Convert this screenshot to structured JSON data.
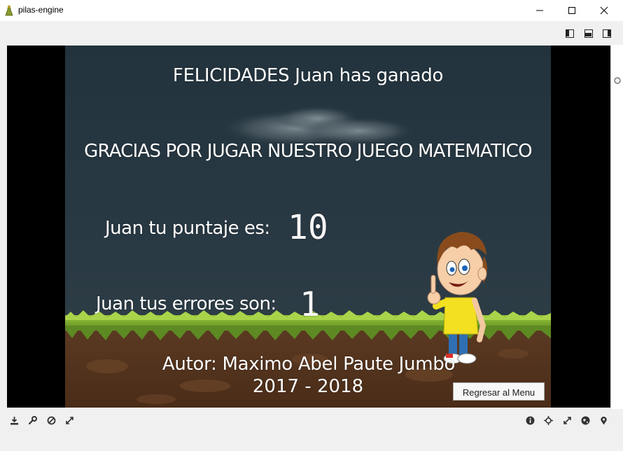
{
  "window": {
    "title": "pilas-engine",
    "controls": {
      "minimize": "minimize-icon",
      "maximize": "maximize-icon",
      "close": "close-icon"
    }
  },
  "layout_buttons": [
    "layout-left-icon",
    "layout-bottom-icon",
    "layout-right-icon"
  ],
  "game": {
    "title": "FELICIDADES Juan has ganado",
    "thanks": "GRACIAS POR JUGAR NUESTRO JUEGO MATEMATICO",
    "score_label": "Juan tu puntaje es:",
    "score_value": "10",
    "errors_label": "Juan tus errores son:",
    "errors_value": "1",
    "author": "Autor: Maximo Abel Paute Jumbo",
    "years": "2017 - 2018",
    "menu_button": "Regresar al Menu"
  },
  "toolbar_left": [
    "download-icon",
    "wrench-icon",
    "stop-icon",
    "expand-icon"
  ],
  "toolbar_right": [
    "info-icon",
    "crosshair-icon",
    "fullscreen-icon",
    "globe-icon",
    "location-pin-icon"
  ],
  "colors": {
    "sky": "#23333d",
    "grass": "#7aa52e",
    "dirt": "#5a3620",
    "text": "#ffffff"
  }
}
